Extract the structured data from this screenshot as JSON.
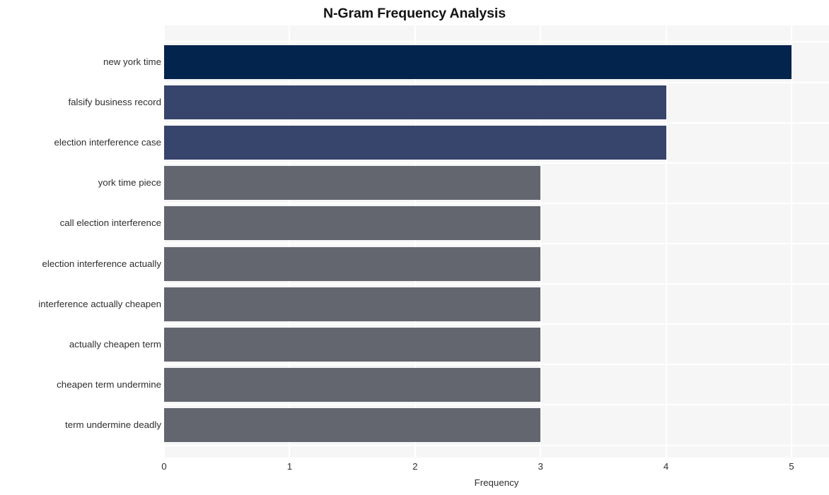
{
  "chart_data": {
    "type": "bar",
    "orientation": "horizontal",
    "title": "N-Gram Frequency Analysis",
    "xlabel": "Frequency",
    "ylabel": "",
    "categories": [
      "new york time",
      "falsify business record",
      "election interference case",
      "york time piece",
      "call election interference",
      "election interference actually",
      "interference actually cheapen",
      "actually cheapen term",
      "cheapen term undermine",
      "term undermine deadly"
    ],
    "values": [
      5,
      4,
      4,
      3,
      3,
      3,
      3,
      3,
      3,
      3
    ],
    "bar_colors": [
      "#03244c",
      "#37446b",
      "#37446b",
      "#63666e",
      "#63666e",
      "#63666e",
      "#63666e",
      "#63666e",
      "#63666e",
      "#63666e"
    ],
    "xlim": [
      0,
      5
    ],
    "xticks": [
      0,
      1,
      2,
      3,
      4,
      5
    ],
    "xtick_labels": [
      "0",
      "1",
      "2",
      "3",
      "4",
      "5"
    ],
    "grid": true,
    "grid_color": "#ffffff",
    "plot_background": "#f6f6f7",
    "figure_background": "#ffffff",
    "legend": null
  }
}
